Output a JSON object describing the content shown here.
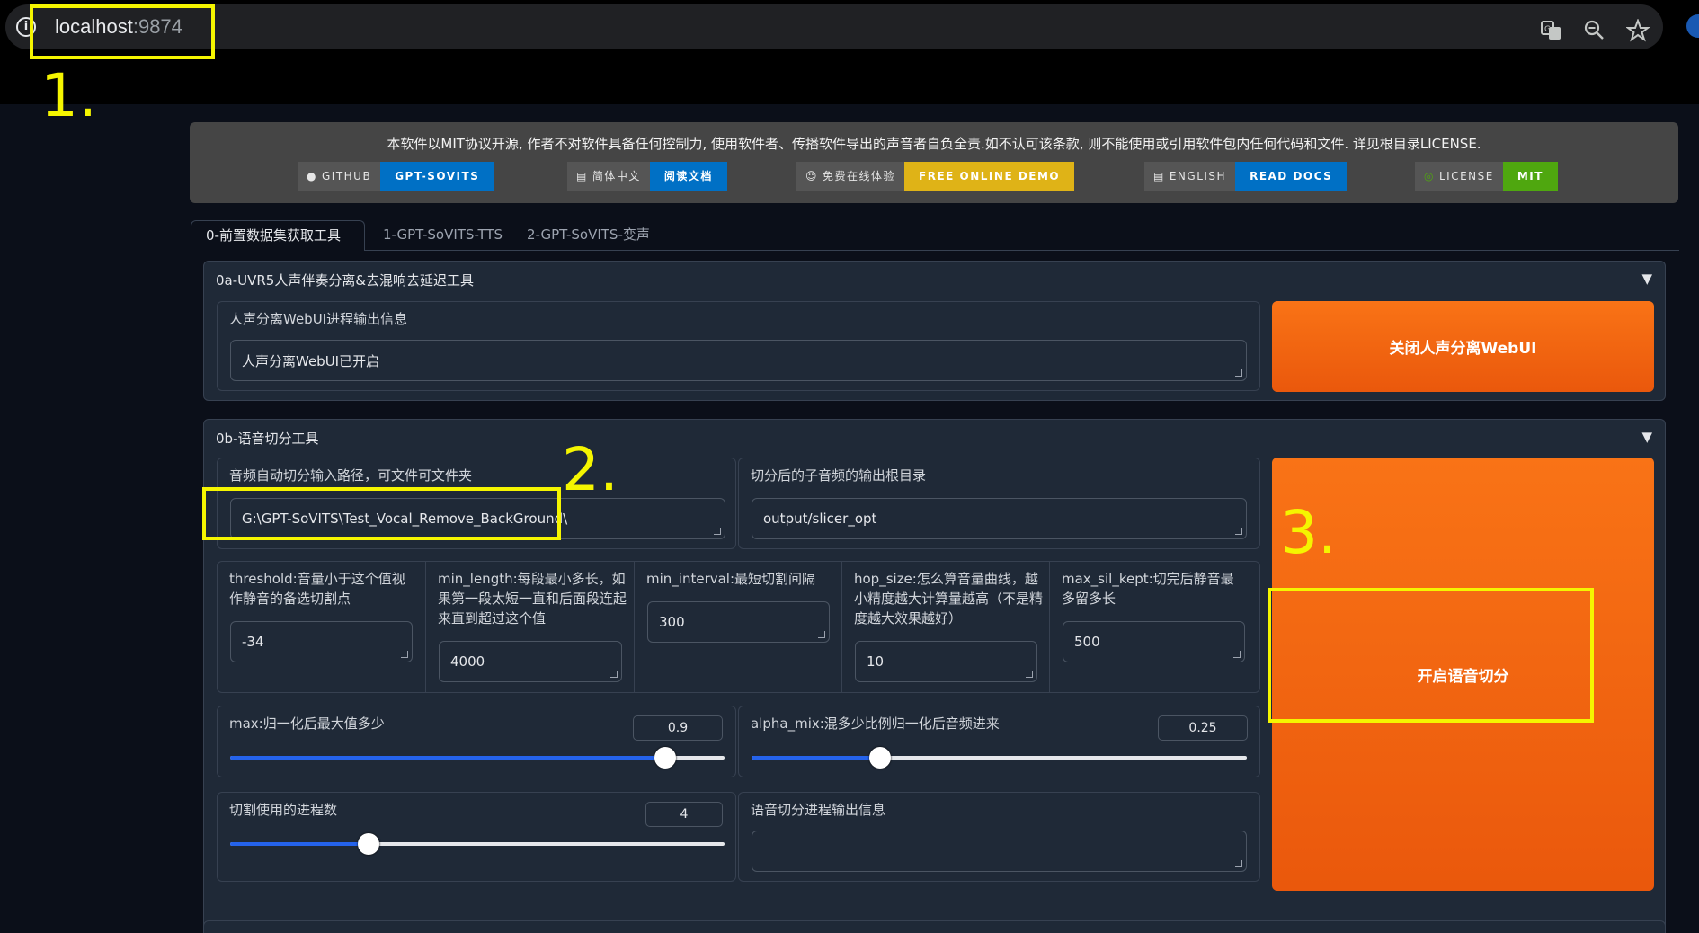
{
  "browser": {
    "host": "localhost",
    "port": ":9874",
    "icons": [
      "info-icon",
      "translate-icon",
      "zoom-icon",
      "star-icon"
    ]
  },
  "annotations": [
    "1.",
    "2.",
    "3."
  ],
  "banner": {
    "text": "本软件以MIT协议开源, 作者不对软件具备任何控制力, 使用软件者、传播软件导出的声音者自负全责.如不认可该条款, 则不能使用或引用软件包内任何代码和文件. 详见根目录LICENSE.",
    "badges": [
      {
        "left": "GITHUB",
        "right": "GPT-SOVITS",
        "icon": "github-icon",
        "color": "blue"
      },
      {
        "left": "简体中文",
        "right": "阅读文档",
        "icon": "document-icon",
        "color": "blue"
      },
      {
        "left": "免费在线体验",
        "right": "FREE ONLINE DEMO",
        "icon": "hugging-face-icon",
        "color": "yellow"
      },
      {
        "left": "ENGLISH",
        "right": "READ DOCS",
        "icon": "document-icon",
        "color": "blue"
      },
      {
        "left": "LICENSE",
        "right": "MIT",
        "icon": "license-icon",
        "color": "green"
      }
    ]
  },
  "tabs": [
    "0-前置数据集获取工具",
    "1-GPT-SoVITS-TTS",
    "2-GPT-SoVITS-变声"
  ],
  "uvr5": {
    "title": "0a-UVR5人声伴奏分离&去混响去延迟工具",
    "info_label": "人声分离WebUI进程输出信息",
    "info_value": "人声分离WebUI已开启",
    "button": "关闭人声分离WebUI"
  },
  "slicer": {
    "title": "0b-语音切分工具",
    "input_label": "音频自动切分输入路径，可文件可文件夹",
    "input_value": "G:\\GPT-SoVITS\\Test_Vocal_Remove_BackGround\\",
    "output_label": "切分后的子音频的输出根目录",
    "output_value": "output/slicer_opt",
    "params": [
      {
        "label": "threshold:音量小于这个值视作静音的备选切割点",
        "value": "-34"
      },
      {
        "label": "min_length:每段最小多长，如果第一段太短一直和后面段连起来直到超过这个值",
        "value": "4000"
      },
      {
        "label": "min_interval:最短切割间隔",
        "value": "300"
      },
      {
        "label": "hop_size:怎么算音量曲线，越小精度越大计算量越高（不是精度越大效果越好）",
        "value": "10"
      },
      {
        "label": "max_sil_kept:切完后静音最多留多长",
        "value": "500"
      }
    ],
    "max_label": "max:归一化后最大值多少",
    "max_value": "0.9",
    "max_fraction": 0.88,
    "alpha_label": "alpha_mix:混多少比例归一化后音频进来",
    "alpha_value": "0.25",
    "alpha_fraction": 0.26,
    "proc_label": "切割使用的进程数",
    "proc_value": "4",
    "proc_fraction": 0.28,
    "out_info_label": "语音切分进程输出信息",
    "out_info_value": "",
    "button": "开启语音切分"
  }
}
